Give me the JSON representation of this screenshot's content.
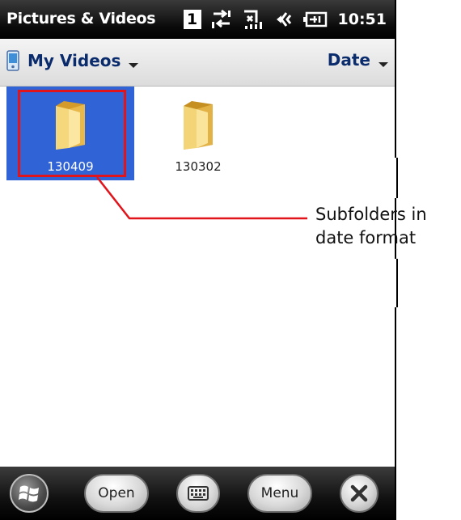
{
  "statusbar": {
    "title": "Pictures & Videos",
    "badge": "1",
    "time": "10:51",
    "icons": [
      "multitask-badge",
      "connectivity-icon",
      "no-signal-icon",
      "speaker-icon",
      "battery-charging-icon"
    ]
  },
  "subheader": {
    "folder_label": "My Videos",
    "sort_label": "Date"
  },
  "folders": [
    {
      "label": "130409",
      "selected": true
    },
    {
      "label": "130302",
      "selected": false
    }
  ],
  "softkeys": {
    "open_label": "Open",
    "menu_label": "Menu"
  },
  "annotation": {
    "text_line1": "Subfolders in",
    "text_line2": "date format",
    "color": "#e2141b"
  },
  "colors": {
    "selection": "#2f63d6",
    "header_text": "#0a2b6c"
  }
}
